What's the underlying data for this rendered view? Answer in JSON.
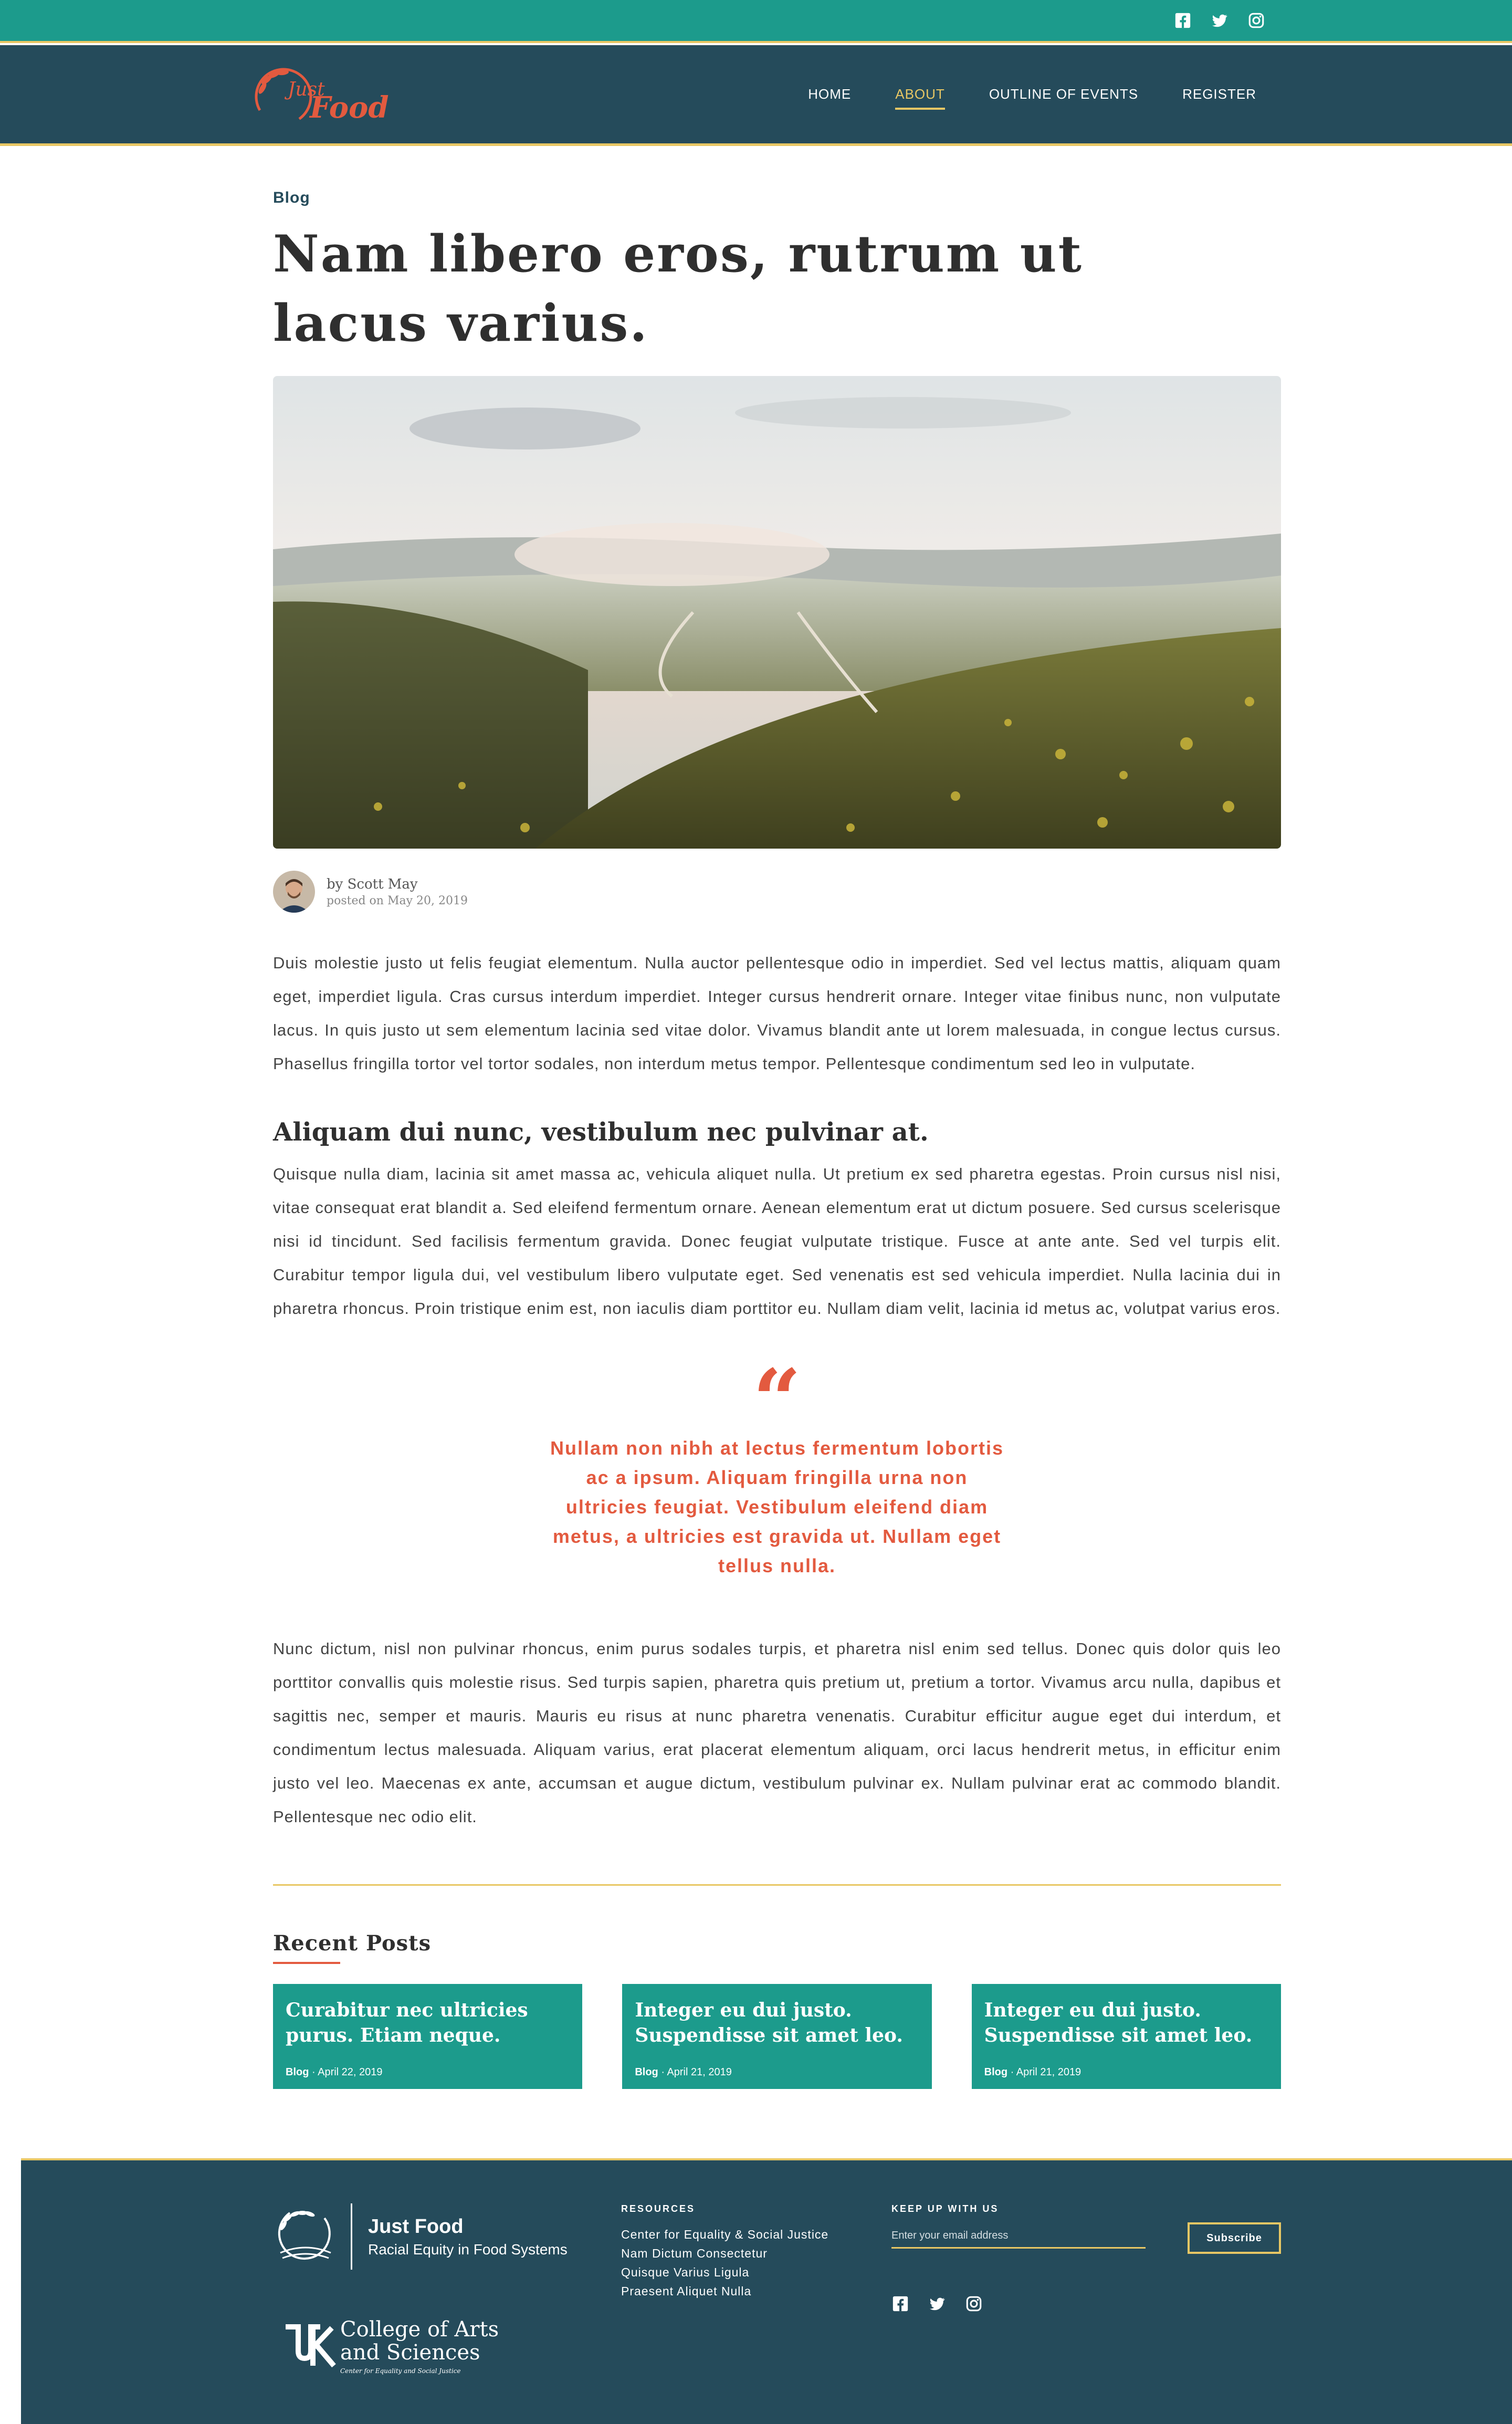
{
  "topbar": {
    "social_icons": [
      "facebook-icon",
      "twitter-icon",
      "instagram-icon"
    ]
  },
  "nav": {
    "logo_text_top": "Just",
    "logo_text_bottom": "Food",
    "items": [
      {
        "label": "HOME",
        "active": false
      },
      {
        "label": "ABOUT",
        "active": true
      },
      {
        "label": "OUTLINE OF EVENTS",
        "active": false
      },
      {
        "label": "REGISTER",
        "active": false
      }
    ]
  },
  "post": {
    "category": "Blog",
    "title": "Nam libero eros, rutrum ut lacus varius.",
    "author": "by Scott May",
    "posted": "posted on May 20, 2019",
    "paragraph1": "Duis molestie justo ut felis feugiat elementum. Nulla auctor pellentesque odio in imperdiet. Sed vel lectus mattis, aliquam quam eget, imperdiet ligula. Cras cursus interdum imperdiet. Integer cursus hendrerit ornare. Integer vitae finibus nunc, non vulputate lacus. In quis justo ut sem elementum lacinia sed vitae dolor. Vivamus blandit ante ut lorem malesuada, in congue lectus cursus. Phasellus fringilla tortor vel tortor sodales, non interdum metus tempor. Pellentesque condimentum sed leo in vulputate.",
    "heading2": "Aliquam dui nunc, vestibulum nec pulvinar at.",
    "paragraph2": "Quisque nulla diam, lacinia sit amet massa ac, vehicula aliquet nulla. Ut pretium ex sed pharetra egestas. Proin cursus nisl nisi, vitae consequat erat blandit a. Sed eleifend fermentum ornare. Aenean elementum erat ut dictum posuere. Sed cursus scelerisque nisi id tincidunt. Sed facilisis fermentum gravida. Donec feugiat vulputate tristique. Fusce at ante ante. Sed vel turpis elit. Curabitur tempor ligula dui, vel vestibulum libero vulputate eget. Sed venenatis est sed vehicula imperdiet. Nulla lacinia dui in pharetra rhoncus. Proin tristique enim est, non iaculis diam porttitor eu. Nullam diam velit, lacinia id metus ac, volutpat varius eros.",
    "quote": "Nullam non nibh at lectus fermentum lobortis ac a ipsum. Aliquam fringilla urna non ultricies feugiat. Vestibulum eleifend diam metus, a ultricies est gravida ut. Nullam eget tellus nulla.",
    "paragraph3": "Nunc dictum, nisl non pulvinar rhoncus, enim purus sodales turpis, et pharetra nisl enim sed tellus. Donec quis dolor quis leo porttitor convallis quis molestie risus. Sed turpis sapien, pharetra quis pretium ut, pretium a tortor. Vivamus arcu nulla, dapibus et sagittis nec, semper et mauris. Mauris eu risus at nunc pharetra venenatis. Curabitur efficitur augue eget dui interdum, et condimentum lectus malesuada. Aliquam varius, erat placerat elementum aliquam, orci lacus hendrerit metus, in efficitur enim justo vel leo. Maecenas ex ante, accumsan et augue dictum, vestibulum pulvinar ex. Nullam pulvinar erat ac commodo blandit. Pellentesque nec odio elit."
  },
  "recent": {
    "title": "Recent Posts",
    "cards": [
      {
        "title": "Curabitur nec ultricies purus. Etiam neque.",
        "category": "Blog",
        "date": "April 22, 2019"
      },
      {
        "title": "Integer eu dui justo. Suspendisse sit amet leo.",
        "category": "Blog",
        "date": "April 21, 2019"
      },
      {
        "title": "Integer eu dui justo. Suspendisse sit amet leo.",
        "category": "Blog",
        "date": "April 21, 2019"
      }
    ]
  },
  "footer": {
    "brand_name": "Just Food",
    "brand_sub": "Racial Equity in Food Systems",
    "college_line1": "College of Arts",
    "college_line2": "and Sciences",
    "college_center": "Center for Equality and Social Justice",
    "resources_heading": "RESOURCES",
    "resources": [
      "Center for Equality & Social Justice",
      "Nam Dictum Consectetur",
      "Quisque Varius Ligula",
      "Praesent Aliquet Nulla"
    ],
    "keep_heading": "KEEP UP WITH US",
    "email_placeholder": "Enter your email address",
    "subscribe_label": "Subscribe"
  },
  "colors": {
    "teal": "#1c9b8c",
    "navy": "#254b5b",
    "gold": "#e8c764",
    "coral": "#e35a3f"
  }
}
